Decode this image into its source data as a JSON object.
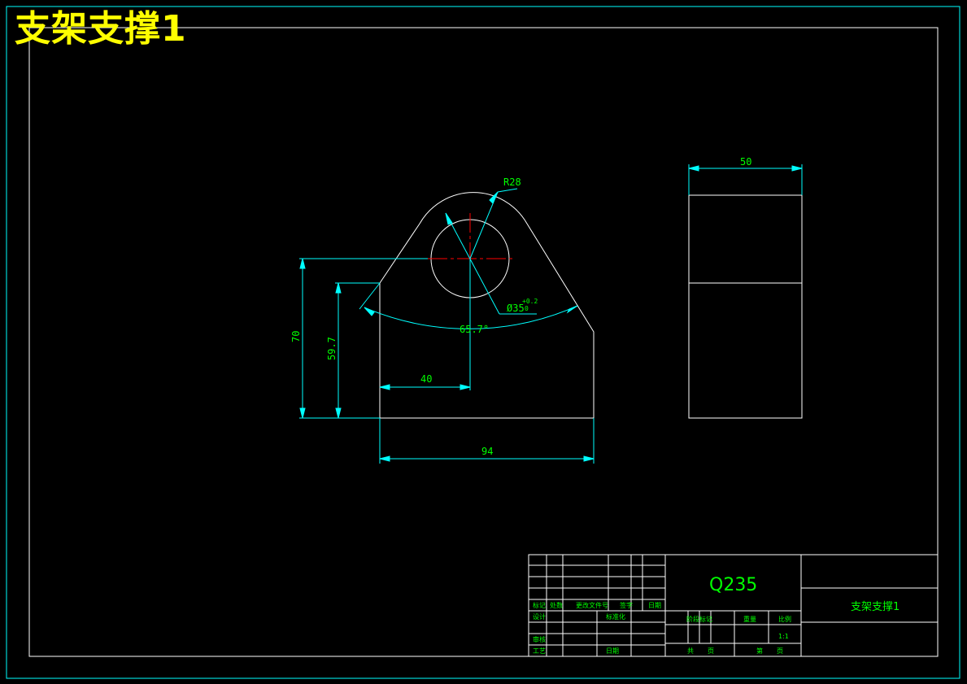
{
  "drawing": {
    "title": "支架支撑1",
    "colors": {
      "background": "#000000",
      "frame": "#00ffff",
      "geometry": "#ffffff",
      "dimension": "#00ffff",
      "dimension_text": "#00ff00",
      "centerline": "#ff0000",
      "title": "#ffff00"
    },
    "dimensions": {
      "radius": "R28",
      "hole": "Ø35",
      "hole_tol_upper": "+0.2",
      "hole_tol_lower": "0",
      "angle": "65.7°",
      "height_total": "70",
      "height_side": "59.7",
      "center_offset": "40",
      "width": "94",
      "side_width": "50"
    },
    "title_block": {
      "material": "Q235",
      "part_name": "支架支撑1",
      "scale": "1:1",
      "headers": [
        "标记",
        "处数",
        "更改文件号",
        "签字",
        "日期"
      ],
      "label_design": "设计",
      "label_standard": "标准化",
      "label_review": "审核",
      "label_process": "工艺",
      "label_date": "日期",
      "label_stage": "阶段标记",
      "label_weight": "重量",
      "label_scale": "比例",
      "label_total_sheets": "共",
      "label_sheet_no": "第",
      "label_page": "页",
      "label_page2": "页"
    }
  }
}
